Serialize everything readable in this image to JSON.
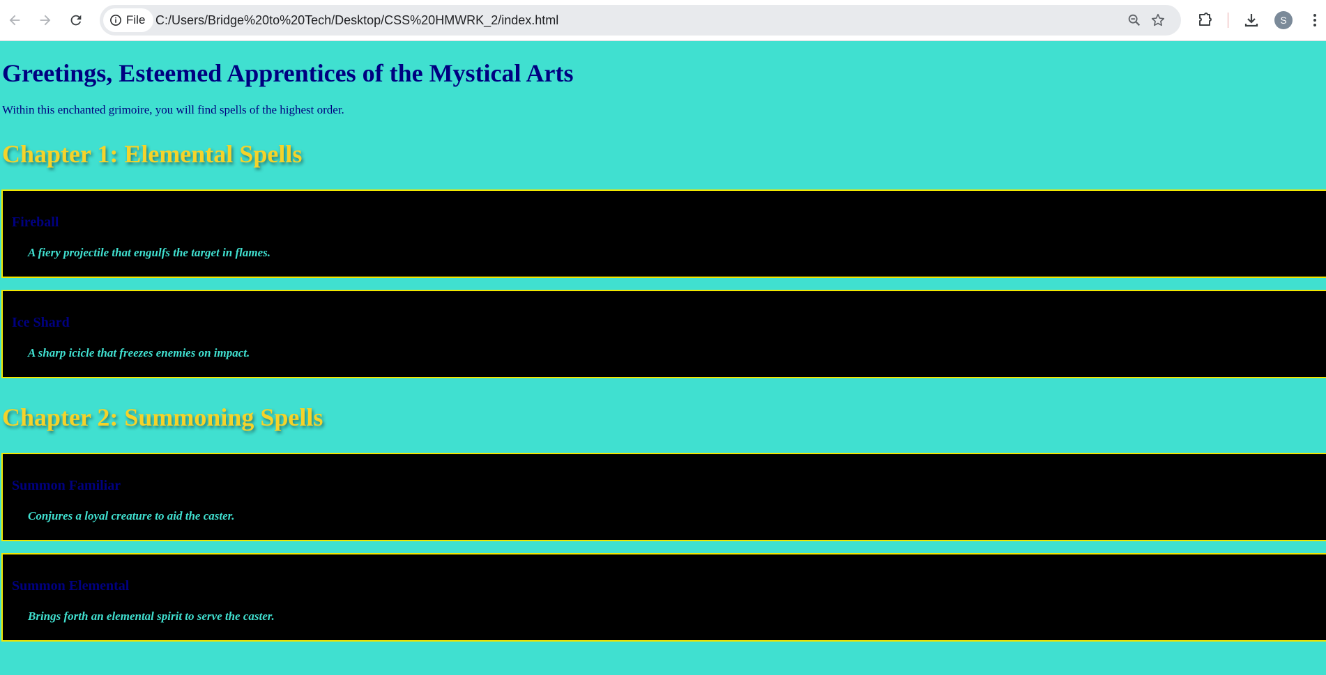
{
  "browser": {
    "site_chip_label": "File",
    "url": "C:/Users/Bridge%20to%20Tech/Desktop/CSS%20HMWRK_2/index.html",
    "profile_initial": "S"
  },
  "page": {
    "heading": "Greetings, Esteemed Apprentices of the Mystical Arts",
    "intro": "Within this enchanted grimoire, you will find spells of the highest order.",
    "chapters": [
      {
        "title": "Chapter 1: Elemental Spells",
        "spells": [
          {
            "name": "Fireball",
            "description": "A fiery projectile that engulfs the target in flames."
          },
          {
            "name": "Ice Shard",
            "description": "A sharp icicle that freezes enemies on impact."
          }
        ]
      },
      {
        "title": "Chapter 2: Summoning Spells",
        "spells": [
          {
            "name": "Summon Familiar",
            "description": "Conjures a loyal creature to aid the caster."
          },
          {
            "name": "Summon Elemental",
            "description": "Brings forth an elemental spirit to serve the caster."
          }
        ]
      }
    ]
  },
  "colors": {
    "page_background": "#40e0d0",
    "heading_text": "#000080",
    "chapter_title": "#f5d32a",
    "spell_background": "#000000",
    "spell_border": "#f2e600",
    "spell_description": "#40e0d0"
  }
}
